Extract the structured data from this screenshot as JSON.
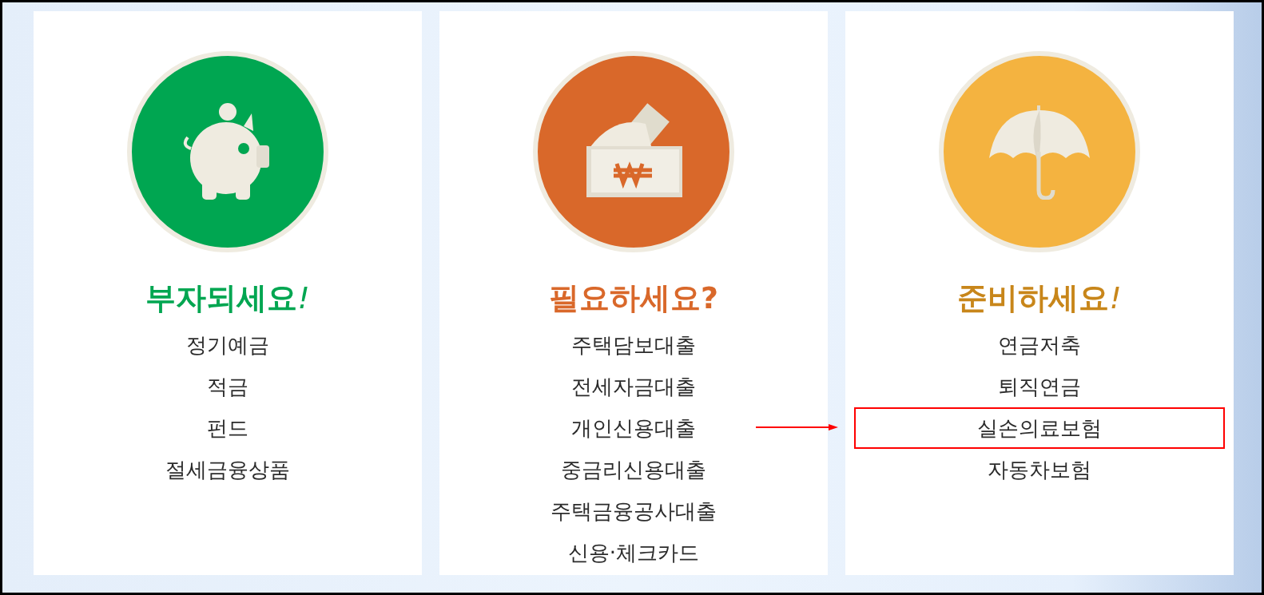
{
  "cards": [
    {
      "kind": "piggy-bank",
      "color": "#00a651",
      "title": "부자되세요",
      "title_mark": "!",
      "items": [
        {
          "label": "정기예금",
          "highlighted": false
        },
        {
          "label": "적금",
          "highlighted": false
        },
        {
          "label": "펀드",
          "highlighted": false
        },
        {
          "label": "절세금융상품",
          "highlighted": false
        }
      ]
    },
    {
      "kind": "money-box",
      "color": "#d9682a",
      "title": "필요하세요?",
      "items": [
        {
          "label": "주택담보대출",
          "highlighted": false
        },
        {
          "label": "전세자금대출",
          "highlighted": false
        },
        {
          "label": "개인신용대출",
          "highlighted": false
        },
        {
          "label": "중금리신용대출",
          "highlighted": false
        },
        {
          "label": "주택금융공사대출",
          "highlighted": false
        },
        {
          "label": "신용·체크카드",
          "highlighted": false
        }
      ]
    },
    {
      "kind": "umbrella",
      "color": "#f4b340",
      "title": "준비하세요",
      "title_mark": "!",
      "items": [
        {
          "label": "연금저축",
          "highlighted": false
        },
        {
          "label": "퇴직연금",
          "highlighted": false
        },
        {
          "label": "실손의료보험",
          "highlighted": true
        },
        {
          "label": "자동차보험",
          "highlighted": false
        }
      ]
    }
  ],
  "annotation": {
    "kind": "arrow"
  }
}
